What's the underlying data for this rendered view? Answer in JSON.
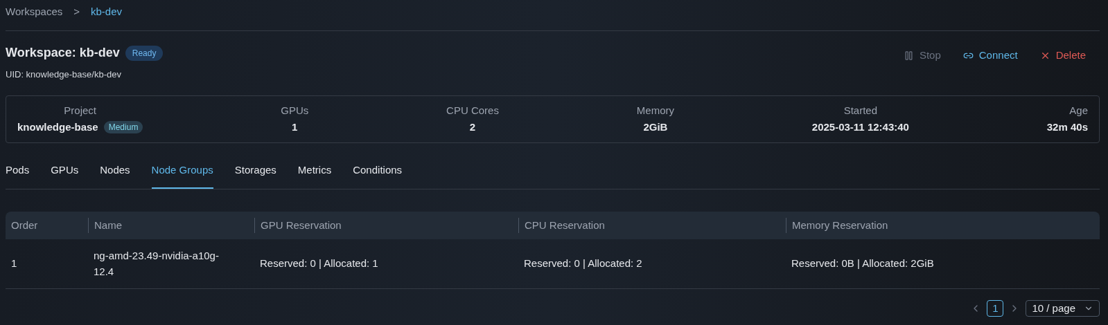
{
  "breadcrumb": [
    {
      "label": "Workspaces",
      "current": false
    },
    {
      "label": "kb-dev",
      "current": true
    }
  ],
  "breadcrumb_separator": ">",
  "header": {
    "title": "Workspace: kb-dev",
    "status": "Ready",
    "uid": "UID: knowledge-base/kb-dev"
  },
  "actions": [
    {
      "kind": "stop",
      "label": "Stop",
      "disabled": true
    },
    {
      "kind": "connect",
      "label": "Connect",
      "disabled": false
    },
    {
      "kind": "delete",
      "label": "Delete",
      "disabled": false
    }
  ],
  "stats": [
    {
      "label": "Project",
      "value": "knowledge-base",
      "badge": "Medium"
    },
    {
      "label": "GPUs",
      "value": "1"
    },
    {
      "label": "CPU Cores",
      "value": "2"
    },
    {
      "label": "Memory",
      "value": "2GiB"
    },
    {
      "label": "Started",
      "value": "2025-03-11 12:43:40"
    },
    {
      "label": "Age",
      "value": "32m 40s"
    }
  ],
  "tabs": [
    {
      "label": "Pods",
      "selected": false
    },
    {
      "label": "GPUs",
      "selected": false
    },
    {
      "label": "Nodes",
      "selected": false
    },
    {
      "label": "Node Groups",
      "selected": true
    },
    {
      "label": "Storages",
      "selected": false
    },
    {
      "label": "Metrics",
      "selected": false
    },
    {
      "label": "Conditions",
      "selected": false
    }
  ],
  "table": {
    "columns": [
      "Order",
      "Name",
      "GPU Reservation",
      "CPU Reservation",
      "Memory Reservation"
    ],
    "rows": [
      [
        "1",
        "ng-amd-23.49-nvidia-a10g-12.4",
        "Reserved: 0 | Allocated: 1",
        "Reserved: 0 | Allocated: 2",
        "Reserved: 0B | Allocated: 2GiB"
      ]
    ]
  },
  "pagination": {
    "pages": [
      {
        "label": "1",
        "selected": true
      }
    ],
    "page_size": "10 / page"
  }
}
